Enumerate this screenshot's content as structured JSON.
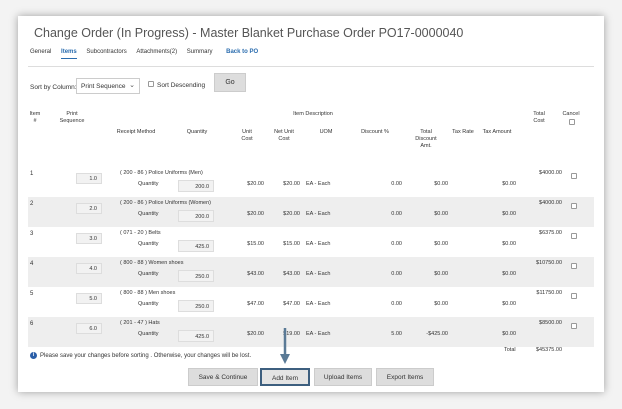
{
  "title": "Change Order (In Progress) - Master Blanket Purchase Order PO17-0000040",
  "tabs": [
    {
      "label": "General"
    },
    {
      "label": "Items"
    },
    {
      "label": "Subcontractors"
    },
    {
      "label": "Attachments(2)"
    },
    {
      "label": "Summary"
    },
    {
      "label": "Back to PO"
    }
  ],
  "sort": {
    "label": "Sort by Column:",
    "selected": "Print Sequence",
    "descending_label": "Sort Descending",
    "go_label": "Go"
  },
  "headers": {
    "item": "Item #",
    "print_sequence": "Print Sequence",
    "item_description": "Item Description",
    "total_cost": "Total Cost",
    "cancel": "Cancel",
    "receipt_method": "Receipt Method",
    "quantity": "Quantity",
    "unit_cost": "Unit Cost",
    "net_unit_cost": "Net Unit Cost",
    "uom": "UOM",
    "discount_pct": "Discount %",
    "total_discount_amt": "Total Discount Amt.",
    "tax_rate": "Tax Rate",
    "tax_amount": "Tax Amount"
  },
  "items": [
    {
      "num": "1",
      "seq": "1.0",
      "desc": "( 200 - 86 )  Police Uniforms (Men)",
      "qty_label": "Quantity",
      "qty": "200.0",
      "unit_cost": "$20.00",
      "net_unit_cost": "$20.00",
      "uom": "EA - Each",
      "discount": "0.00",
      "total_discount": "$0.00",
      "tax_amount": "$0.00",
      "total_cost": "$4000.00"
    },
    {
      "num": "2",
      "seq": "2.0",
      "desc": "( 200 - 86 )  Police Uniforms (Women)",
      "qty_label": "Quantity",
      "qty": "200.0",
      "unit_cost": "$20.00",
      "net_unit_cost": "$20.00",
      "uom": "EA - Each",
      "discount": "0.00",
      "total_discount": "$0.00",
      "tax_amount": "$0.00",
      "total_cost": "$4000.00"
    },
    {
      "num": "3",
      "seq": "3.0",
      "desc": "( 071 - 20 )  Belts",
      "qty_label": "Quantity",
      "qty": "425.0",
      "unit_cost": "$15.00",
      "net_unit_cost": "$15.00",
      "uom": "EA - Each",
      "discount": "0.00",
      "total_discount": "$0.00",
      "tax_amount": "$0.00",
      "total_cost": "$6375.00"
    },
    {
      "num": "4",
      "seq": "4.0",
      "desc": "( 800 - 88 )  Women shoes",
      "qty_label": "Quantity",
      "qty": "250.0",
      "unit_cost": "$43.00",
      "net_unit_cost": "$43.00",
      "uom": "EA - Each",
      "discount": "0.00",
      "total_discount": "$0.00",
      "tax_amount": "$0.00",
      "total_cost": "$10750.00"
    },
    {
      "num": "5",
      "seq": "5.0",
      "desc": "( 800 - 88 )  Men shoes",
      "qty_label": "Quantity",
      "qty": "250.0",
      "unit_cost": "$47.00",
      "net_unit_cost": "$47.00",
      "uom": "EA - Each",
      "discount": "0.00",
      "total_discount": "$0.00",
      "tax_amount": "$0.00",
      "total_cost": "$11750.00"
    },
    {
      "num": "6",
      "seq": "6.0",
      "desc": "( 201 - 47 )  Hats",
      "qty_label": "Quantity",
      "qty": "425.0",
      "unit_cost": "$20.00",
      "net_unit_cost": "$19.00",
      "uom": "EA - Each",
      "discount": "5.00",
      "total_discount": "-$425.00",
      "tax_amount": "$0.00",
      "total_cost": "$8500.00"
    }
  ],
  "totals": {
    "label": "Total",
    "value": "$45375.00"
  },
  "notice": "Please save your changes before sorting . Otherwise, your changes will be lost.",
  "buttons": {
    "save": "Save & Continue",
    "add": "Add Item",
    "upload": "Upload Items",
    "export": "Export Items"
  },
  "colors": {
    "accent": "#2a6cae",
    "highlight_border": "#3d5f7f",
    "row_alt": "#eeeeee"
  }
}
